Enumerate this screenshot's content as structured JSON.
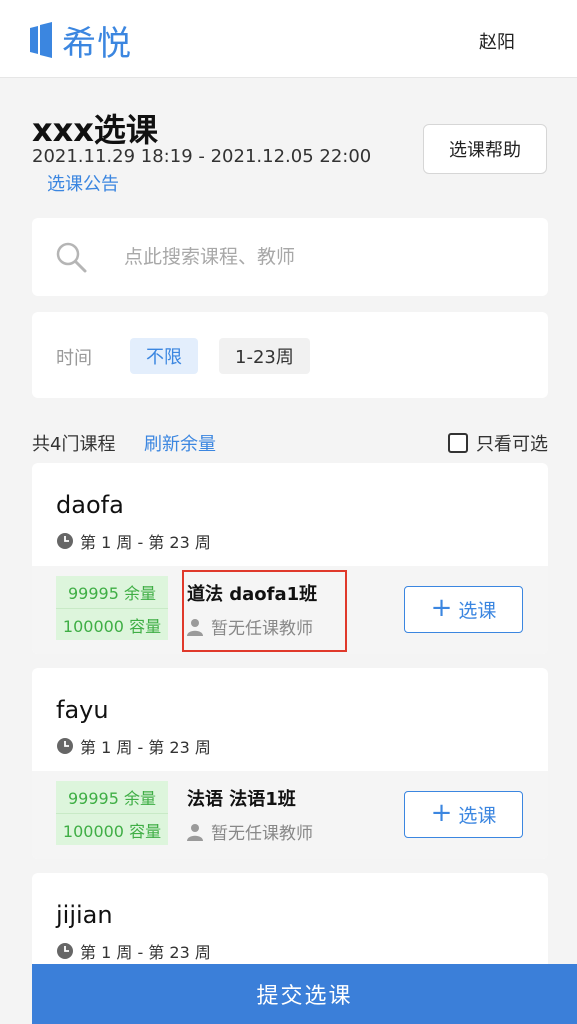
{
  "header": {
    "brand": "希悦",
    "user_name": "赵阳"
  },
  "page": {
    "title": "xxx选课",
    "time_range": "2021.11.29 18:19 - 2021.12.05 22:00",
    "notice_link": "选课公告",
    "help_button": "选课帮助"
  },
  "search": {
    "placeholder": "点此搜索课程、教师"
  },
  "filter": {
    "label": "时间",
    "options": [
      "不限",
      "1-23周"
    ],
    "selected": "不限"
  },
  "list": {
    "count_text": "共4门课程",
    "refresh_link": "刷新余量",
    "only_available_label": "只看可选",
    "only_available_checked": false
  },
  "courses": [
    {
      "name": "daofa",
      "weeks": "第 1 周 - 第 23 周",
      "class": {
        "remaining": "99995 余量",
        "capacity": "100000 容量",
        "name": "道法 daofa1班",
        "teacher": "暂无任课教师",
        "button": "选课"
      }
    },
    {
      "name": "fayu",
      "weeks": "第 1 周 - 第 23 周",
      "class": {
        "remaining": "99995 余量",
        "capacity": "100000 容量",
        "name": "法语 法语1班",
        "teacher": "暂无任课教师",
        "button": "选课"
      }
    },
    {
      "name": "jijian",
      "weeks": "第 1 周 - 第 23 周"
    }
  ],
  "submit_button": "提交选课",
  "colors": {
    "accent": "#3b86e0",
    "quota_bg": "#ddf5dc",
    "quota_text": "#3fae45",
    "highlight": "#e0392b",
    "submit_bg": "#3b7fd9"
  }
}
